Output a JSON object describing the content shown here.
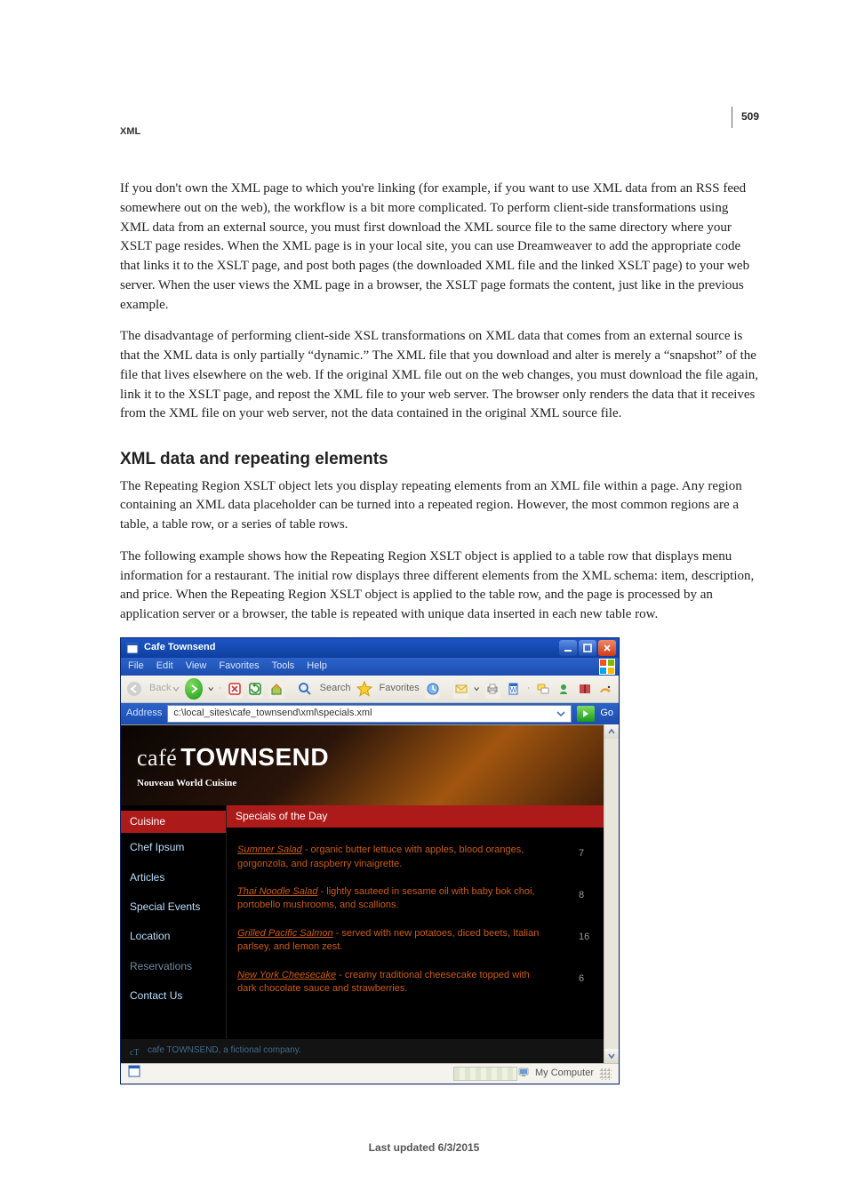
{
  "page_number": "509",
  "section_label": "XML",
  "paragraphs": {
    "p1": "If you don't own the XML page to which you're linking (for example, if you want to use XML data from an RSS feed somewhere out on the web), the workflow is a bit more complicated. To perform client-side transformations using XML data from an external source, you must first download the XML source file to the same directory where your XSLT page resides. When the XML page is in your local site, you can use Dreamweaver to add the appropriate code that links it to the XSLT page, and post both pages (the downloaded XML file and the linked XSLT page) to your web server. When the user views the XML page in a browser, the XSLT page formats the content, just like in the previous example.",
    "p2": "The disadvantage of performing client-side XSL transformations on XML data that comes from an external source is that the XML data is only partially “dynamic.” The XML file that you download and alter is merely a “snapshot” of the file that lives elsewhere on the web. If the original XML file out on the web changes, you must download the file again, link it to the XSLT page, and repost the XML file to your web server. The browser only renders the data that it receives from the XML file on your web server, not the data contained in the original XML source file.",
    "p3": "The Repeating Region XSLT object lets you display repeating elements from an XML file within a page. Any region containing an XML data placeholder can be turned into a repeated region. However, the most common regions are a table, a table row, or a series of table rows.",
    "p4": "The following example shows how the Repeating Region XSLT object is applied to a table row that displays menu information for a restaurant. The initial row displays three different elements from the XML schema: item, description, and price. When the Repeating Region XSLT object is applied to the table row, and the page is processed by an application server or a browser, the table is repeated with unique data inserted in each new table row."
  },
  "heading": "XML data and repeating elements",
  "footer_text": "Last updated 6/3/2015",
  "browser": {
    "window_title": "Cafe Townsend",
    "menubar": [
      "File",
      "Edit",
      "View",
      "Favorites",
      "Tools",
      "Help"
    ],
    "toolbar": {
      "back_label": "Back",
      "search_label": "Search",
      "favorites_label": "Favorites"
    },
    "address_label": "Address",
    "address_value": "c:\\local_sites\\cafe_townsend\\xml\\specials.xml",
    "go_label": "Go",
    "statusbar_zone": "My Computer"
  },
  "cafe": {
    "logo_word1": "café",
    "logo_word2": "TOWNSEND",
    "tagline": "Nouveau World Cuisine",
    "nav_head": "Cuisine",
    "nav_items": [
      "Chef Ipsum",
      "Articles",
      "Special Events",
      "Location",
      "Reservations",
      "Contact Us"
    ],
    "main_head": "Specials of the Day",
    "specials": [
      {
        "title": "Summer Salad",
        "desc": " - organic butter lettuce with apples, blood oranges, gorgonzola, and raspberry vinaigrette.",
        "price": "7"
      },
      {
        "title": "Thai Noodle Salad",
        "desc": " - lightly sauteed in sesame oil with baby bok choi, portobello mushrooms, and scallions.",
        "price": "8"
      },
      {
        "title": "Grilled Pacific Salmon",
        "desc": " - served with new potatoes, diced beets, Italian parlsey, and lemon zest.",
        "price": "16"
      },
      {
        "title": "New York Cheesecake",
        "desc": " - creamy traditional cheesecake topped with dark chocolate sauce and strawberries.",
        "price": "6"
      }
    ],
    "footer_text": "cafe TOWNSEND, a fictional company."
  }
}
